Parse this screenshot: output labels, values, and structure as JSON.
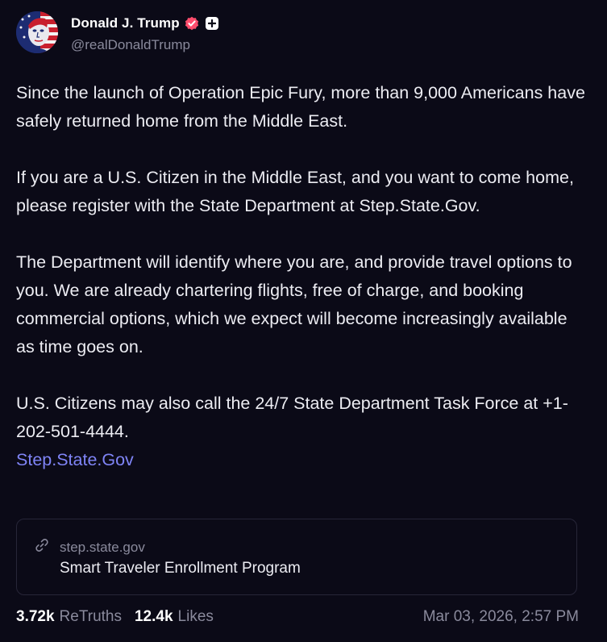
{
  "author": {
    "display_name": "Donald J. Trump",
    "handle": "@realDonaldTrump",
    "avatar_icon": "portrait-flag-avatar",
    "verified_icon": "verified-badge-icon",
    "plus_icon": "plus-badge-icon",
    "verified_color": "#ff4d6d"
  },
  "post": {
    "paragraphs": [
      "Since the launch of Operation Epic Fury, more than 9,000 Americans have safely returned home from the Middle East.",
      "If you are a U.S. Citizen in the Middle East, and you want to come home, please register with the State Department at Step.State.Gov.",
      "The Department will identify where you are, and provide travel options to you. We are already chartering flights, free of charge, and booking commercial options, which we expect will become increasingly available as time goes on.",
      "U.S. Citizens may also call the 24/7 State Department Task Force at +1-202-501-4444."
    ],
    "link_text": "Step.State.Gov",
    "link_color": "#7f84f6"
  },
  "link_card": {
    "icon": "link-icon",
    "domain": "step.state.gov",
    "title": "Smart Traveler Enrollment Program"
  },
  "footer": {
    "retruths_count": "3.72k",
    "retruths_label": "ReTruths",
    "likes_count": "12.4k",
    "likes_label": "Likes",
    "timestamp": "Mar 03, 2026, 2:57 PM"
  },
  "colors": {
    "background": "#0b0a17",
    "text": "#ececf2",
    "muted": "#8a8a9c",
    "card_border": "#272638"
  }
}
